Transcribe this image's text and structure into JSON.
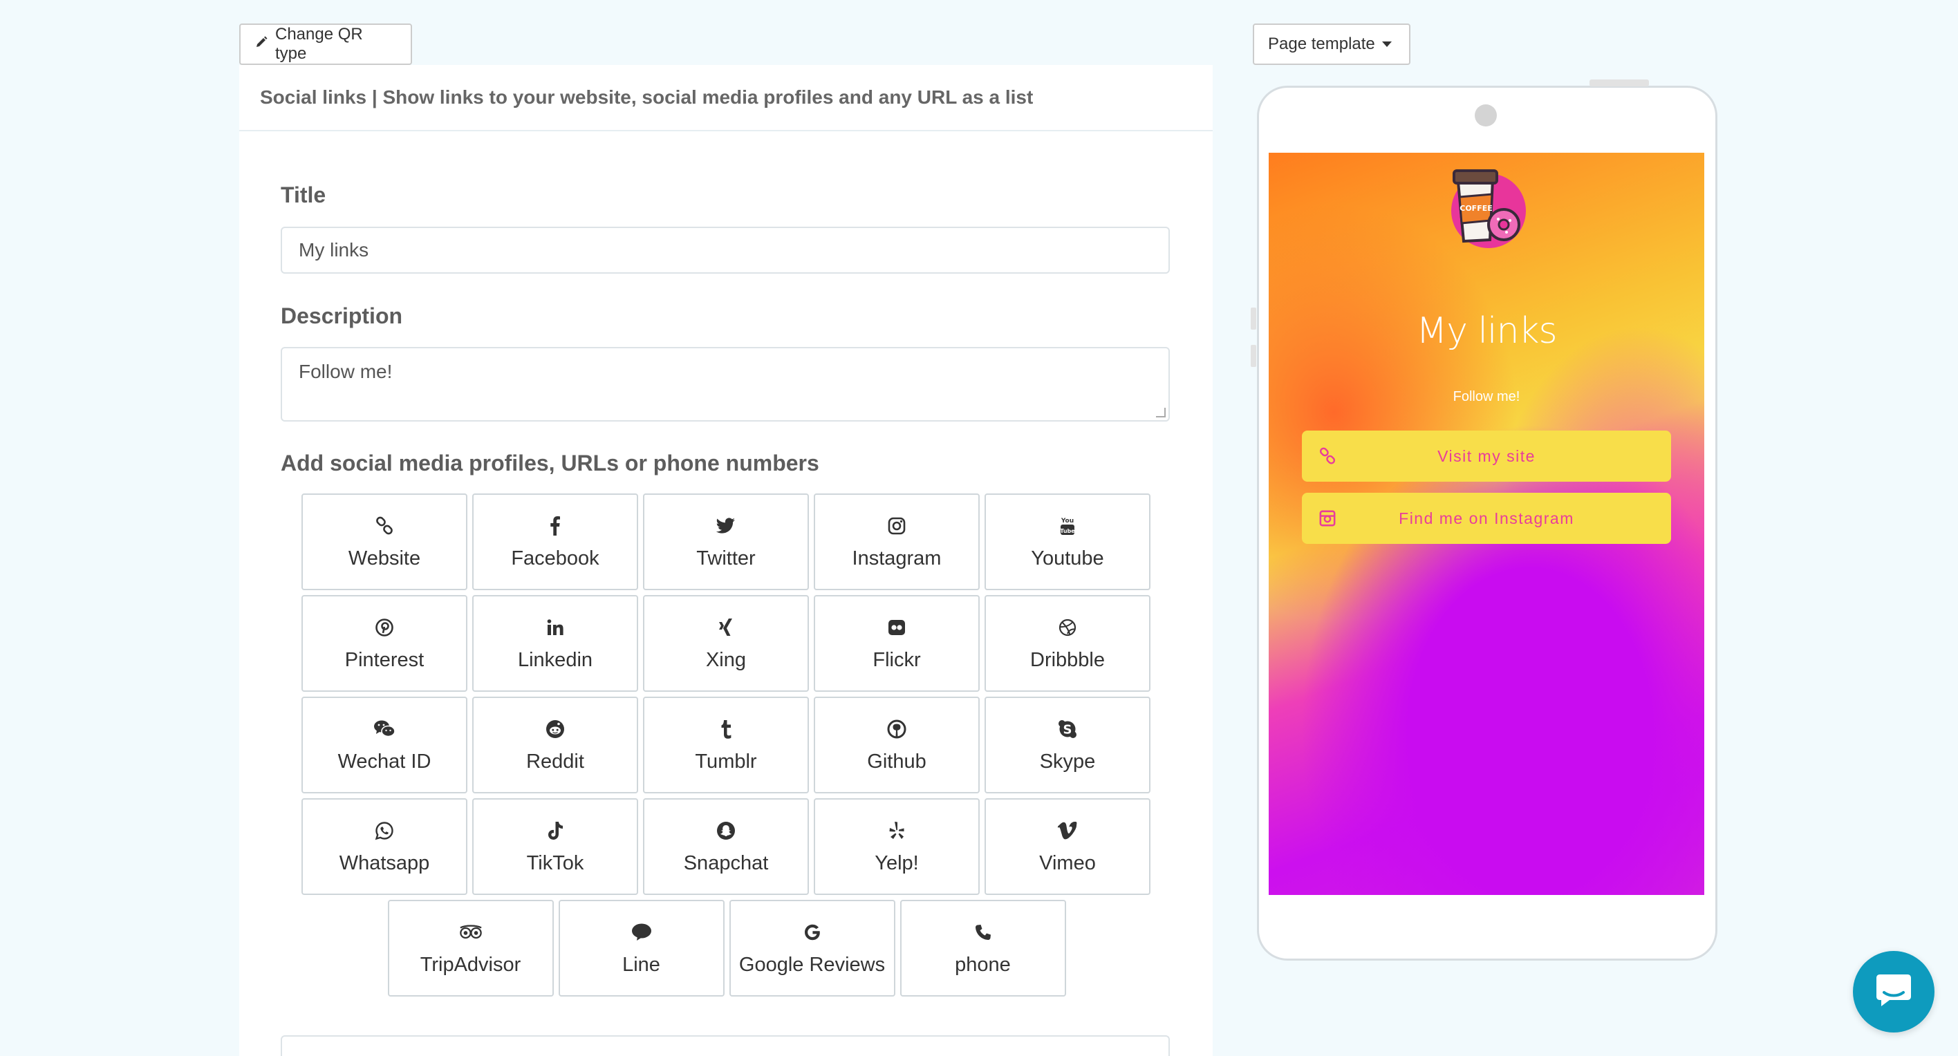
{
  "toolbar": {
    "change_qr_type_label": "Change QR type",
    "page_template_label": "Page template"
  },
  "editor": {
    "header": "Social links | Show links to your website, social media profiles and any URL as a list",
    "title_label": "Title",
    "title_value": "My links",
    "description_label": "Description",
    "description_value": "Follow me!",
    "add_label": "Add social media profiles, URLs or phone numbers"
  },
  "social_options": [
    {
      "label": "Website",
      "icon": "link-icon"
    },
    {
      "label": "Facebook",
      "icon": "facebook-icon"
    },
    {
      "label": "Twitter",
      "icon": "twitter-icon"
    },
    {
      "label": "Instagram",
      "icon": "instagram-icon"
    },
    {
      "label": "Youtube",
      "icon": "youtube-icon"
    },
    {
      "label": "Pinterest",
      "icon": "pinterest-icon"
    },
    {
      "label": "Linkedin",
      "icon": "linkedin-icon"
    },
    {
      "label": "Xing",
      "icon": "xing-icon"
    },
    {
      "label": "Flickr",
      "icon": "flickr-icon"
    },
    {
      "label": "Dribbble",
      "icon": "dribbble-icon"
    },
    {
      "label": "Wechat ID",
      "icon": "wechat-icon"
    },
    {
      "label": "Reddit",
      "icon": "reddit-icon"
    },
    {
      "label": "Tumblr",
      "icon": "tumblr-icon"
    },
    {
      "label": "Github",
      "icon": "github-icon"
    },
    {
      "label": "Skype",
      "icon": "skype-icon"
    },
    {
      "label": "Whatsapp",
      "icon": "whatsapp-icon"
    },
    {
      "label": "TikTok",
      "icon": "tiktok-icon"
    },
    {
      "label": "Snapchat",
      "icon": "snapchat-icon"
    },
    {
      "label": "Yelp!",
      "icon": "yelp-icon"
    },
    {
      "label": "Vimeo",
      "icon": "vimeo-icon"
    },
    {
      "label": "TripAdvisor",
      "icon": "tripadvisor-icon"
    },
    {
      "label": "Line",
      "icon": "line-icon"
    },
    {
      "label": "Google Reviews",
      "icon": "google-icon"
    },
    {
      "label": "phone",
      "icon": "phone-icon"
    }
  ],
  "preview": {
    "title": "My links",
    "description": "Follow me!",
    "logo_text": "COFFEE",
    "links": [
      {
        "label": "Visit my site",
        "icon": "link-icon"
      },
      {
        "label": "Find me on Instagram",
        "icon": "instagram-icon"
      }
    ],
    "colors": {
      "button_bg": "#f8de4a",
      "button_text": "#e83d9b",
      "gradient_top": "#ff7d1e",
      "gradient_mid": "#f8de4a",
      "gradient_bottom": "#c90cf0"
    }
  },
  "chat": {
    "icon": "chat-icon",
    "color": "#0e9bbe"
  }
}
